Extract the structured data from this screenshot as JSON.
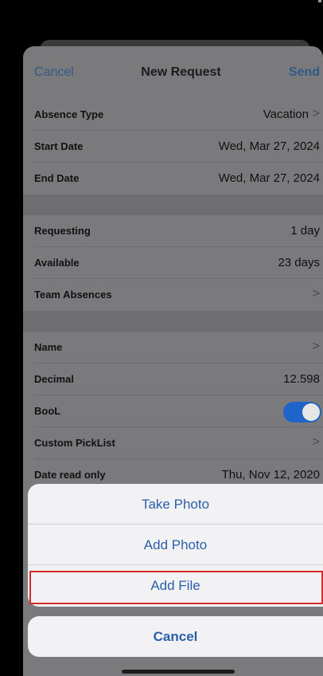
{
  "navbar": {
    "cancel_label": "Cancel",
    "title": "New Request",
    "send_label": "Send"
  },
  "form": {
    "section1": [
      {
        "label": "Absence Type",
        "value": "Vacation",
        "chevron": true
      },
      {
        "label": "Start Date",
        "value": "Wed, Mar 27, 2024",
        "chevron": false
      },
      {
        "label": "End Date",
        "value": "Wed, Mar 27, 2024",
        "chevron": false
      }
    ],
    "section2": [
      {
        "label": "Requesting",
        "value": "1 day",
        "chevron": false
      },
      {
        "label": "Available",
        "value": "23 days",
        "chevron": false
      },
      {
        "label": "Team Absences",
        "value": "",
        "chevron": true
      }
    ],
    "section3": [
      {
        "label": "Name",
        "value": "",
        "chevron": true
      },
      {
        "label": "Decimal",
        "value": "12.598",
        "chevron": false
      },
      {
        "label": "BooL",
        "toggle": true
      },
      {
        "label": "Custom PickList",
        "value": "",
        "chevron": true
      },
      {
        "label": "Date read only",
        "value": "Thu, Nov 12, 2020",
        "chevron": false
      }
    ],
    "chevron_glyph": ">",
    "bool_value": true
  },
  "action_sheet": {
    "items": [
      {
        "label": "Take Photo"
      },
      {
        "label": "Add Photo"
      },
      {
        "label": "Add File",
        "highlighted": true
      }
    ],
    "cancel_label": "Cancel"
  },
  "colors": {
    "accent": "#2b5fa8",
    "toggle_on": "#1f64c8",
    "highlight_border": "#d22c2c"
  }
}
